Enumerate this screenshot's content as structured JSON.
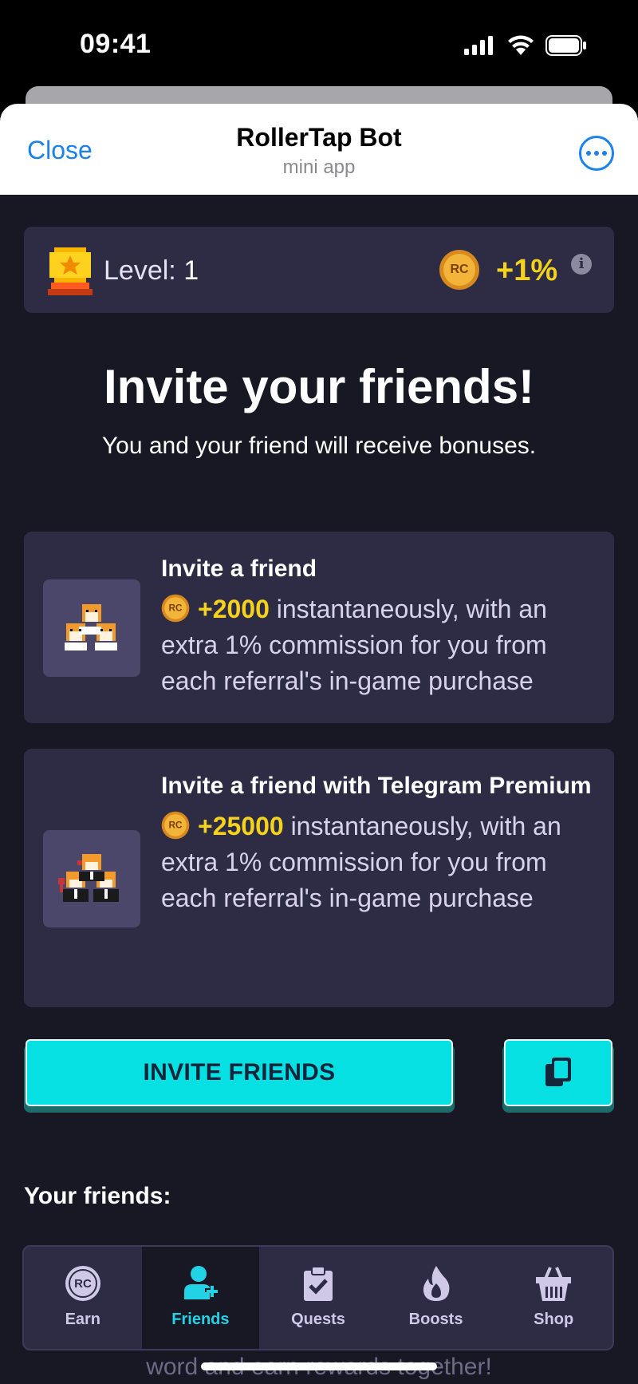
{
  "status_bar": {
    "time": "09:41"
  },
  "header": {
    "close": "Close",
    "title": "RollerTap Bot",
    "subtitle": "mini app"
  },
  "level": {
    "label": "Level:",
    "value": "1",
    "bonus": "+1%"
  },
  "hero": {
    "title": "Invite your friends!",
    "subtitle": "You and your friend will receive bonuses."
  },
  "cards": [
    {
      "title": "Invite a friend",
      "reward": "+2000",
      "desc": "instantaneously, with an extra 1% commission for you from each referral's in-game purchase"
    },
    {
      "title": "Invite a friend with Telegram Premium",
      "reward": "+25000",
      "desc": "instantaneously, with an extra 1% commission for you from each referral's in-game purchase"
    }
  ],
  "actions": {
    "invite": "INVITE FRIENDS"
  },
  "friends": {
    "heading": "Your friends:"
  },
  "under_text": "word and earn rewards together!",
  "tabs": [
    {
      "label": "Earn",
      "icon": "rc-coin-icon"
    },
    {
      "label": "Friends",
      "icon": "add-friend-icon"
    },
    {
      "label": "Quests",
      "icon": "clipboard-check-icon"
    },
    {
      "label": "Boosts",
      "icon": "flame-icon"
    },
    {
      "label": "Shop",
      "icon": "basket-icon"
    }
  ],
  "colors": {
    "accent": "#06e0e3",
    "gold": "#f5d21c",
    "active_tab": "#22d3e6",
    "card": "#2d2c44",
    "bg": "#181825"
  }
}
